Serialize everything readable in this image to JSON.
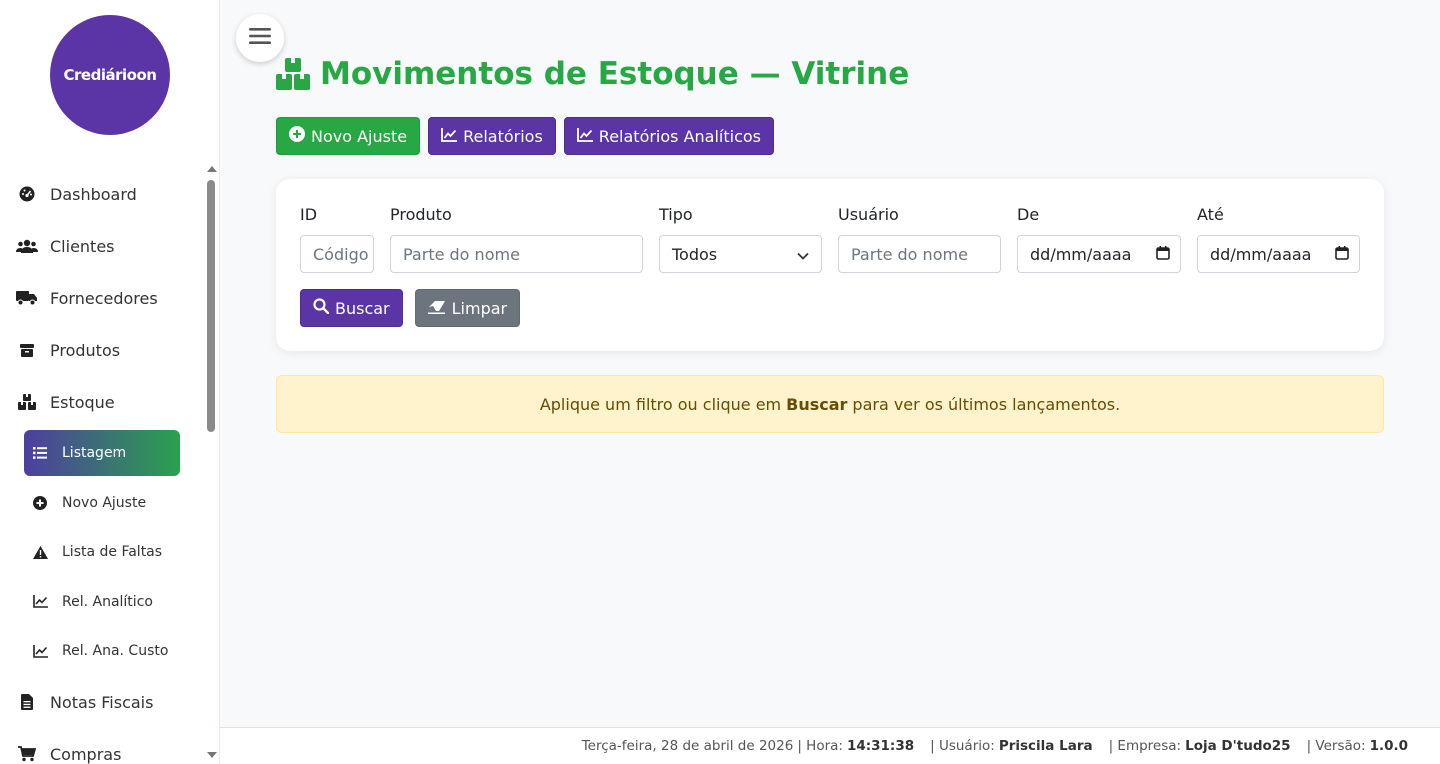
{
  "brand": {
    "logo_text": "Crediárioon",
    "logo_color": "#5b35a6"
  },
  "sidebar": {
    "items": [
      {
        "label": "Dashboard",
        "icon": "dashboard-icon"
      },
      {
        "label": "Clientes",
        "icon": "users-icon"
      },
      {
        "label": "Fornecedores",
        "icon": "truck-icon"
      },
      {
        "label": "Produtos",
        "icon": "box-icon"
      },
      {
        "label": "Estoque",
        "icon": "boxes-icon"
      }
    ],
    "estoque_sub": [
      {
        "label": "Listagem",
        "icon": "list-icon",
        "active": true
      },
      {
        "label": "Novo Ajuste",
        "icon": "plus-circle-icon"
      },
      {
        "label": "Lista de Faltas",
        "icon": "warning-icon"
      },
      {
        "label": "Rel. Analítico",
        "icon": "chart-line-icon"
      },
      {
        "label": "Rel. Ana. Custo",
        "icon": "chart-line-icon"
      }
    ],
    "items_after": [
      {
        "label": "Notas Fiscais",
        "icon": "file-icon"
      },
      {
        "label": "Compras",
        "icon": "cart-icon"
      }
    ]
  },
  "page": {
    "title": "Movimentos de Estoque — Vitrine",
    "title_color": "#28a745"
  },
  "actions": {
    "new_adjust": "Novo Ajuste",
    "reports": "Relatórios",
    "analytic_reports": "Relatórios Analíticos"
  },
  "filters": {
    "id_label": "ID",
    "id_placeholder": "Código",
    "product_label": "Produto",
    "product_placeholder": "Parte do nome",
    "type_label": "Tipo",
    "type_value": "Todos",
    "user_label": "Usuário",
    "user_placeholder": "Parte do nome",
    "from_label": "De",
    "from_value": "dd/mm/aaaa",
    "to_label": "Até",
    "to_value": "dd/mm/aaaa",
    "search_button": "Buscar",
    "clear_button": "Limpar"
  },
  "alert": {
    "before": "Aplique um filtro ou clique em",
    "strong": "Buscar",
    "after": "para ver os últimos lançamentos."
  },
  "footer": {
    "date": "Terça-feira, 28 de abril de 2026",
    "time_label": "| Hora:",
    "time": "14:31:38",
    "user_label": "| Usuário:",
    "user": "Priscila Lara",
    "company_label": "| Empresa:",
    "company": "Loja D'tudo25",
    "version_label": "| Versão:",
    "version": "1.0.0"
  }
}
